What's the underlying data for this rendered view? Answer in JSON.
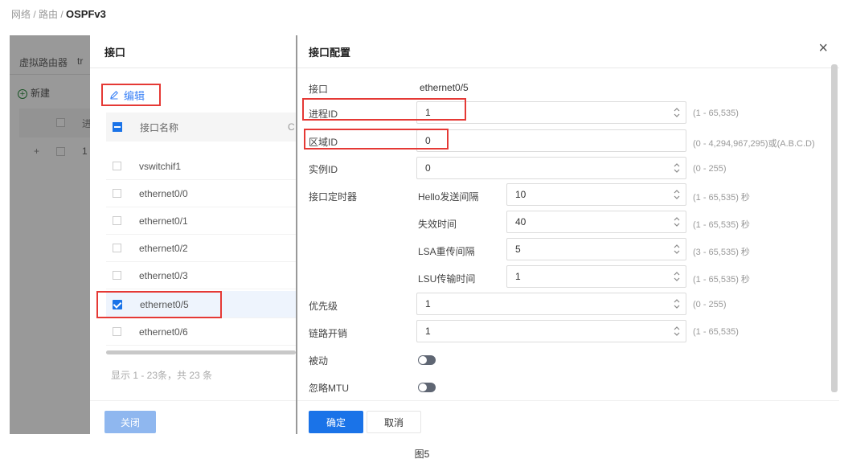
{
  "breadcrumb": {
    "prefix": "网络 / 路由 / ",
    "current": "OSPFv3"
  },
  "background": {
    "tab_router": "虚拟路由器",
    "tab_partial": "tr",
    "new_button": "新建",
    "col_partial": "进",
    "row_expand": "+",
    "row_value": "1"
  },
  "list_drawer": {
    "title": "接口",
    "edit_button": "编辑",
    "column_name": "接口名称",
    "column_partial": "C",
    "rows": [
      {
        "name": "vswitchif1",
        "checked": false
      },
      {
        "name": "ethernet0/0",
        "checked": false
      },
      {
        "name": "ethernet0/1",
        "checked": false
      },
      {
        "name": "ethernet0/2",
        "checked": false
      },
      {
        "name": "ethernet0/3",
        "checked": false
      },
      {
        "name": "ethernet0/5",
        "checked": true
      },
      {
        "name": "ethernet0/6",
        "checked": false
      }
    ],
    "total_text": "显示 1 - 23条，共 23 条",
    "close_button": "关闭"
  },
  "config_drawer": {
    "title": "接口配置",
    "close_icon": "×",
    "interface": {
      "label": "接口",
      "value": "ethernet0/5"
    },
    "process_id": {
      "label": "进程ID",
      "value": "1",
      "hint": "(1 - 65,535)"
    },
    "area_id": {
      "label": "区域ID",
      "value": "0",
      "hint": "(0 - 4,294,967,295)或(A.B.C.D)"
    },
    "instance_id": {
      "label": "实例ID",
      "value": "0",
      "hint": "(0 - 255)"
    },
    "timers": {
      "label": "接口定时器",
      "hello": {
        "label": "Hello发送间隔",
        "value": "10",
        "hint": "(1 - 65,535) 秒"
      },
      "dead": {
        "label": "失效时间",
        "value": "40",
        "hint": "(1 - 65,535) 秒"
      },
      "lsa": {
        "label": "LSA重传间隔",
        "value": "5",
        "hint": "(3 - 65,535) 秒"
      },
      "lsu": {
        "label": "LSU传输时间",
        "value": "1",
        "hint": "(1 - 65,535) 秒"
      }
    },
    "priority": {
      "label": "优先级",
      "value": "1",
      "hint": "(0 - 255)"
    },
    "cost": {
      "label": "链路开销",
      "value": "1",
      "hint": "(1 - 65,535)"
    },
    "passive": {
      "label": "被动",
      "enabled": false
    },
    "ignore_mtu": {
      "label": "忽略MTU",
      "enabled": false
    },
    "ok_button": "确定",
    "cancel_button": "取消"
  },
  "caption": "图5",
  "colors": {
    "primary": "#1a73e8",
    "highlight_red": "#e53935",
    "disabled_blue": "#8fb7ef"
  }
}
